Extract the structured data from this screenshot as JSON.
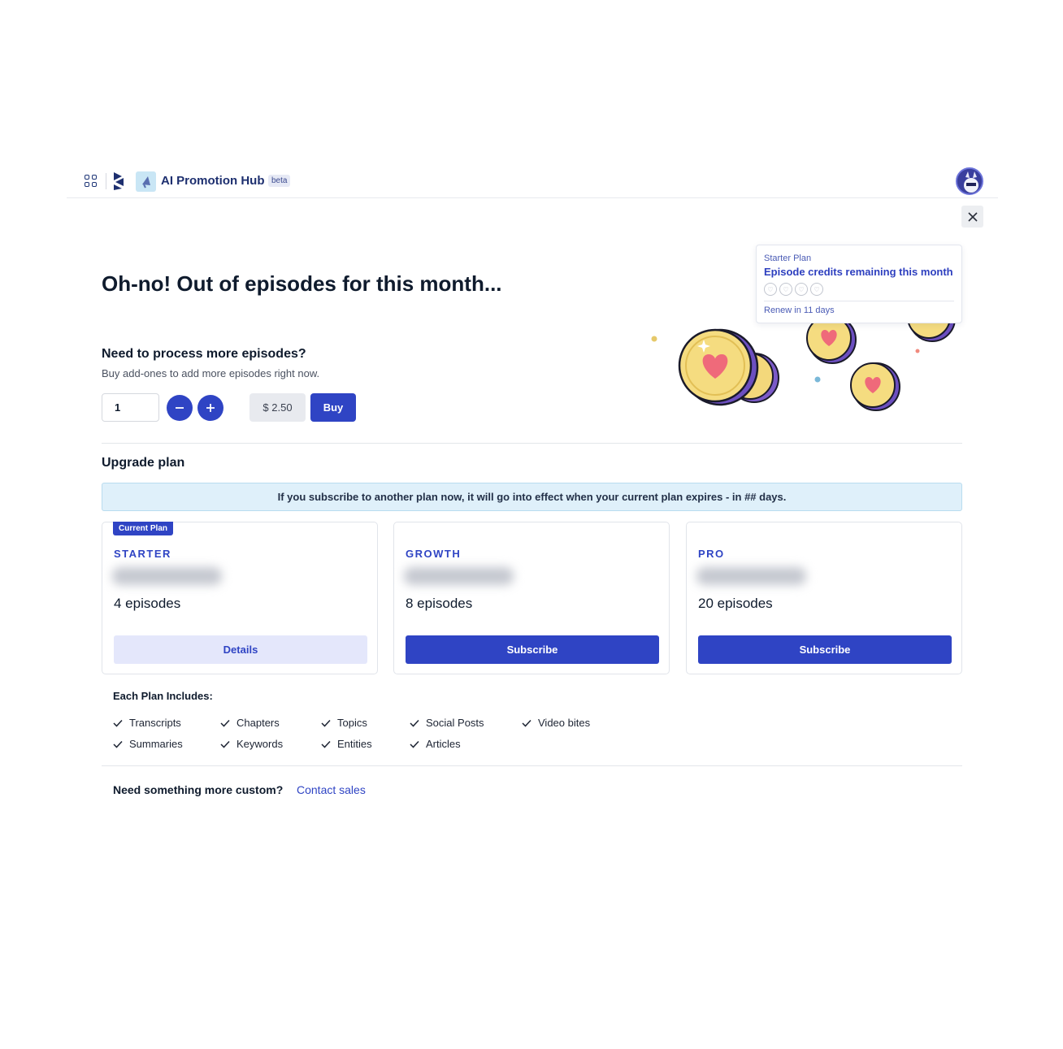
{
  "header": {
    "app_title": "AI Promotion Hub",
    "beta_label": "beta"
  },
  "colors": {
    "accent": "#2f44c4",
    "accent_soft": "#e4e7fb",
    "notice_bg": "#dff0fa"
  },
  "headline": "Oh-no! Out of episodes for this month...",
  "credits": {
    "plan": "Starter Plan",
    "title": "Episode credits remaining this month",
    "credits_total": 4,
    "credits_remaining": 0,
    "renew": "Renew in 11 days"
  },
  "addons": {
    "title": "Need to process more episodes?",
    "subtitle": "Buy add-ones to add more episodes right now.",
    "quantity": "1",
    "price": "$ 2.50",
    "buy_label": "Buy"
  },
  "upgrade": {
    "title": "Upgrade plan",
    "notice": "If you subscribe to another plan now, it will go into effect when your current plan expires - in ## days.",
    "plans": [
      {
        "tag": "Current Plan",
        "name": "STARTER",
        "episodes": "4 episodes",
        "button": "Details"
      },
      {
        "name": "GROWTH",
        "episodes": "8 episodes",
        "button": "Subscribe"
      },
      {
        "name": "PRO",
        "episodes": "20 episodes",
        "button": "Subscribe"
      }
    ]
  },
  "includes": {
    "title": "Each Plan Includes:",
    "features": [
      "Transcripts",
      "Summaries",
      "Chapters",
      "Keywords",
      "Topics",
      "Entities",
      "Social Posts",
      "Articles",
      "Video bites"
    ]
  },
  "footer": {
    "custom_text": "Need something more custom?",
    "contact_label": "Contact sales"
  }
}
